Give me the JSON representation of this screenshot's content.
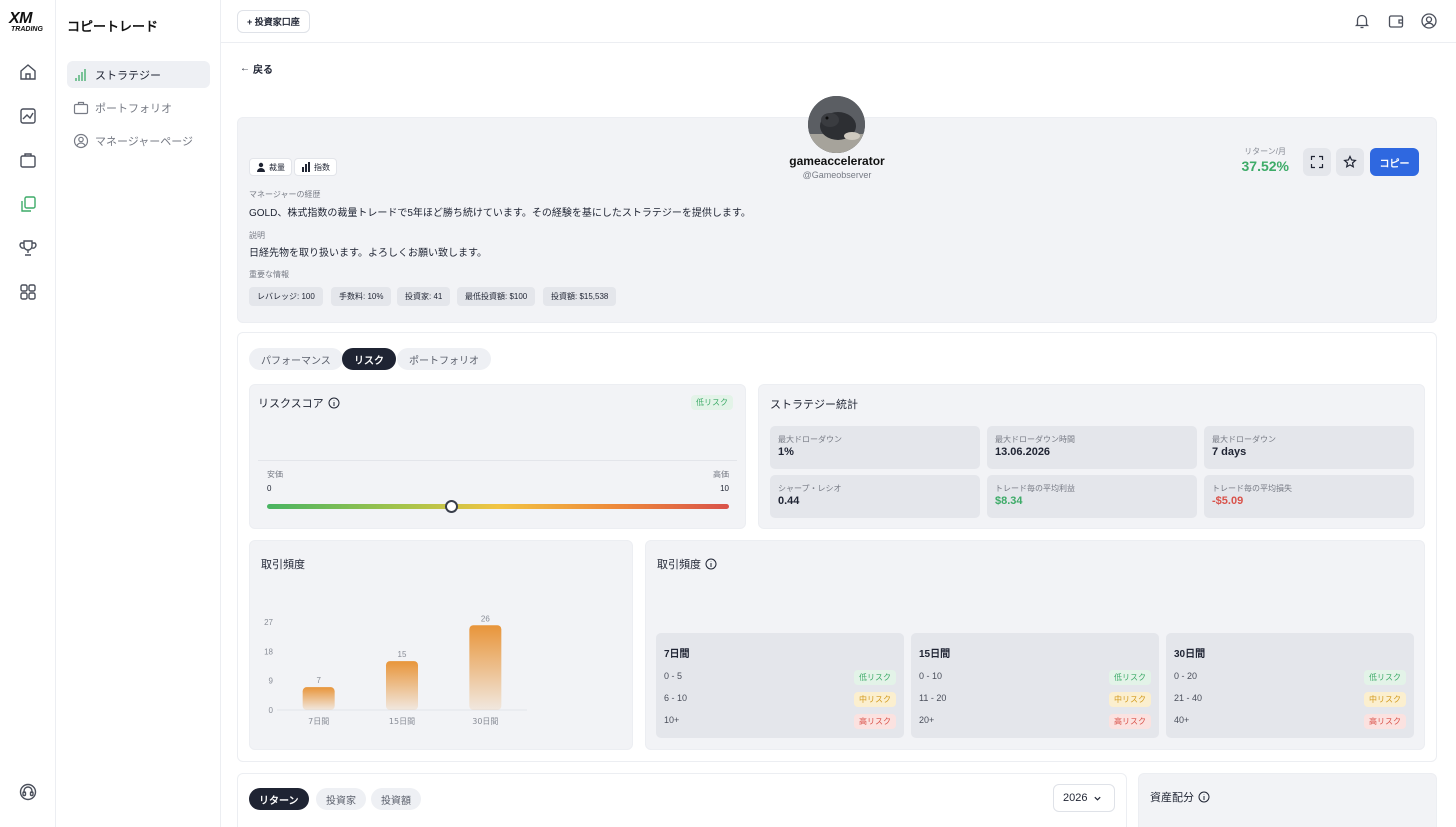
{
  "brand": {
    "logo_main": "XM",
    "logo_sub": "TRADING"
  },
  "sidebar": {
    "title": "コピートレード",
    "items": [
      {
        "label": "ストラテジー",
        "icon": "bar-chart-icon",
        "active": true
      },
      {
        "label": "ポートフォリオ",
        "icon": "briefcase-icon",
        "active": false
      },
      {
        "label": "マネージャーページ",
        "icon": "user-circle-icon",
        "active": false
      }
    ]
  },
  "topbar": {
    "add_investor_label": "+ 投資家口座"
  },
  "back_label": "戻る",
  "profile": {
    "name": "gameaccelerator",
    "handle": "@Gameobserver",
    "tags": [
      {
        "label": "裁量",
        "icon": "person-icon"
      },
      {
        "label": "指数",
        "icon": "bars-icon"
      }
    ],
    "return_label": "リターン/月",
    "return_value": "37.52%",
    "copy_label": "コピー",
    "manager_history_label": "マネージャーの経歴",
    "manager_history": "GOLD、株式指数の裁量トレードで5年ほど勝ち続けています。その経験を基にしたストラテジーを提供します。",
    "description_label": "説明",
    "description": "日経先物を取り扱います。よろしくお願い致します。",
    "key_info_label": "重要な情報",
    "key_info": [
      "レバレッジ: 100",
      "手数料: 10%",
      "投資家: 41",
      "最低投資額: $100",
      "投資額: $15,538"
    ]
  },
  "tabs": [
    "パフォーマンス",
    "リスク",
    "ポートフォリオ"
  ],
  "active_tab": "リスク",
  "risk_score": {
    "title": "リスクスコア",
    "badge": "低リスク",
    "min_label": "安価",
    "max_label": "高価",
    "min_value": "0",
    "max_value": "10",
    "score": 4
  },
  "strategy_stats": {
    "title": "ストラテジー統計",
    "items": [
      {
        "label": "最大ドローダウン",
        "value": "1%",
        "color": "#1f2433"
      },
      {
        "label": "最大ドローダウン時間",
        "value": "13.06.2026",
        "color": "#1f2433"
      },
      {
        "label": "最大ドローダウン",
        "value": "7 days",
        "color": "#1f2433"
      },
      {
        "label": "シャープ・レシオ",
        "value": "0.44",
        "color": "#1f2433"
      },
      {
        "label": "トレード毎の平均利益",
        "value": "$8.34",
        "color": "#3dab68"
      },
      {
        "label": "トレード毎の平均損失",
        "value": "-$5.09",
        "color": "#d9524a"
      }
    ]
  },
  "trade_freq_chart": {
    "title": "取引頻度"
  },
  "chart_data": {
    "type": "bar",
    "categories": [
      "7日間",
      "15日間",
      "30日間"
    ],
    "values": [
      7,
      15,
      26
    ],
    "ticks": [
      0,
      9,
      18,
      27
    ],
    "ylim": [
      0,
      27
    ],
    "title": "取引頻度",
    "xlabel": "",
    "ylabel": "",
    "grid": false,
    "bar_color": "#e8953a"
  },
  "trade_freq_table": {
    "title": "取引頻度",
    "periods": [
      {
        "title": "7日間",
        "rows": [
          {
            "range": "0 - 5",
            "risk": "低リスク",
            "level": "low"
          },
          {
            "range": "6 - 10",
            "risk": "中リスク",
            "level": "mid"
          },
          {
            "range": "10+",
            "risk": "高リスク",
            "level": "high"
          }
        ]
      },
      {
        "title": "15日間",
        "rows": [
          {
            "range": "0 - 10",
            "risk": "低リスク",
            "level": "low"
          },
          {
            "range": "11 - 20",
            "risk": "中リスク",
            "level": "mid"
          },
          {
            "range": "20+",
            "risk": "高リスク",
            "level": "high"
          }
        ]
      },
      {
        "title": "30日間",
        "rows": [
          {
            "range": "0 - 20",
            "risk": "低リスク",
            "level": "low"
          },
          {
            "range": "21 - 40",
            "risk": "中リスク",
            "level": "mid"
          },
          {
            "range": "40+",
            "risk": "高リスク",
            "level": "high"
          }
        ]
      }
    ]
  },
  "bottom": {
    "tabs": [
      "リターン",
      "投資家",
      "投資額"
    ],
    "active": "リターン",
    "year": "2026",
    "asset_title": "資産配分"
  },
  "colors": {
    "accent": "#2f68e0",
    "positive": "#3dab68",
    "negative": "#d9524a",
    "warning": "#d39a1d"
  }
}
